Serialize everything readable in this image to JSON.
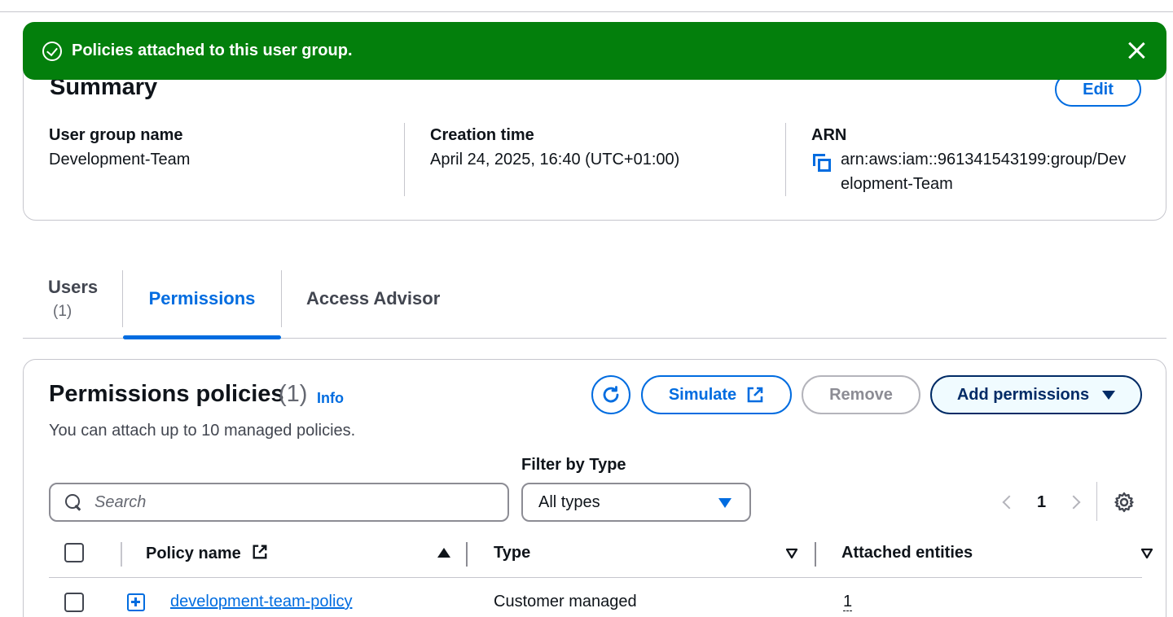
{
  "flash": {
    "message": "Policies attached to this user group.",
    "color": "#037f0c"
  },
  "summary": {
    "title": "Summary",
    "edit_label": "Edit",
    "group_name_label": "User group name",
    "group_name_value": "Development-Team",
    "creation_time_label": "Creation time",
    "creation_time_value": "April 24, 2025, 16:40 (UTC+01:00)",
    "arn_label": "ARN",
    "arn_value": "arn:aws:iam::961341543199:group/Development-Team"
  },
  "tabs": [
    {
      "label": "Users",
      "count": "(1)"
    },
    {
      "label": "Permissions"
    },
    {
      "label": "Access Advisor"
    }
  ],
  "permissions": {
    "title": "Permissions policies",
    "count": "(1)",
    "info_label": "Info",
    "description": "You can attach up to 10 managed policies.",
    "simulate_label": "Simulate",
    "remove_label": "Remove",
    "add_permissions_label": "Add permissions",
    "filter_label": "Filter by Type",
    "search_placeholder": "Search",
    "type_selected": "All types",
    "page_number": "1",
    "columns": [
      "Policy name",
      "Type",
      "Attached entities"
    ],
    "rows": [
      {
        "policy_name": "development-team-policy",
        "type": "Customer managed",
        "attached_entities": "1"
      }
    ]
  },
  "colors": {
    "accent": "#006ce0",
    "success": "#037f0c",
    "primary_dark": "#002b66"
  }
}
